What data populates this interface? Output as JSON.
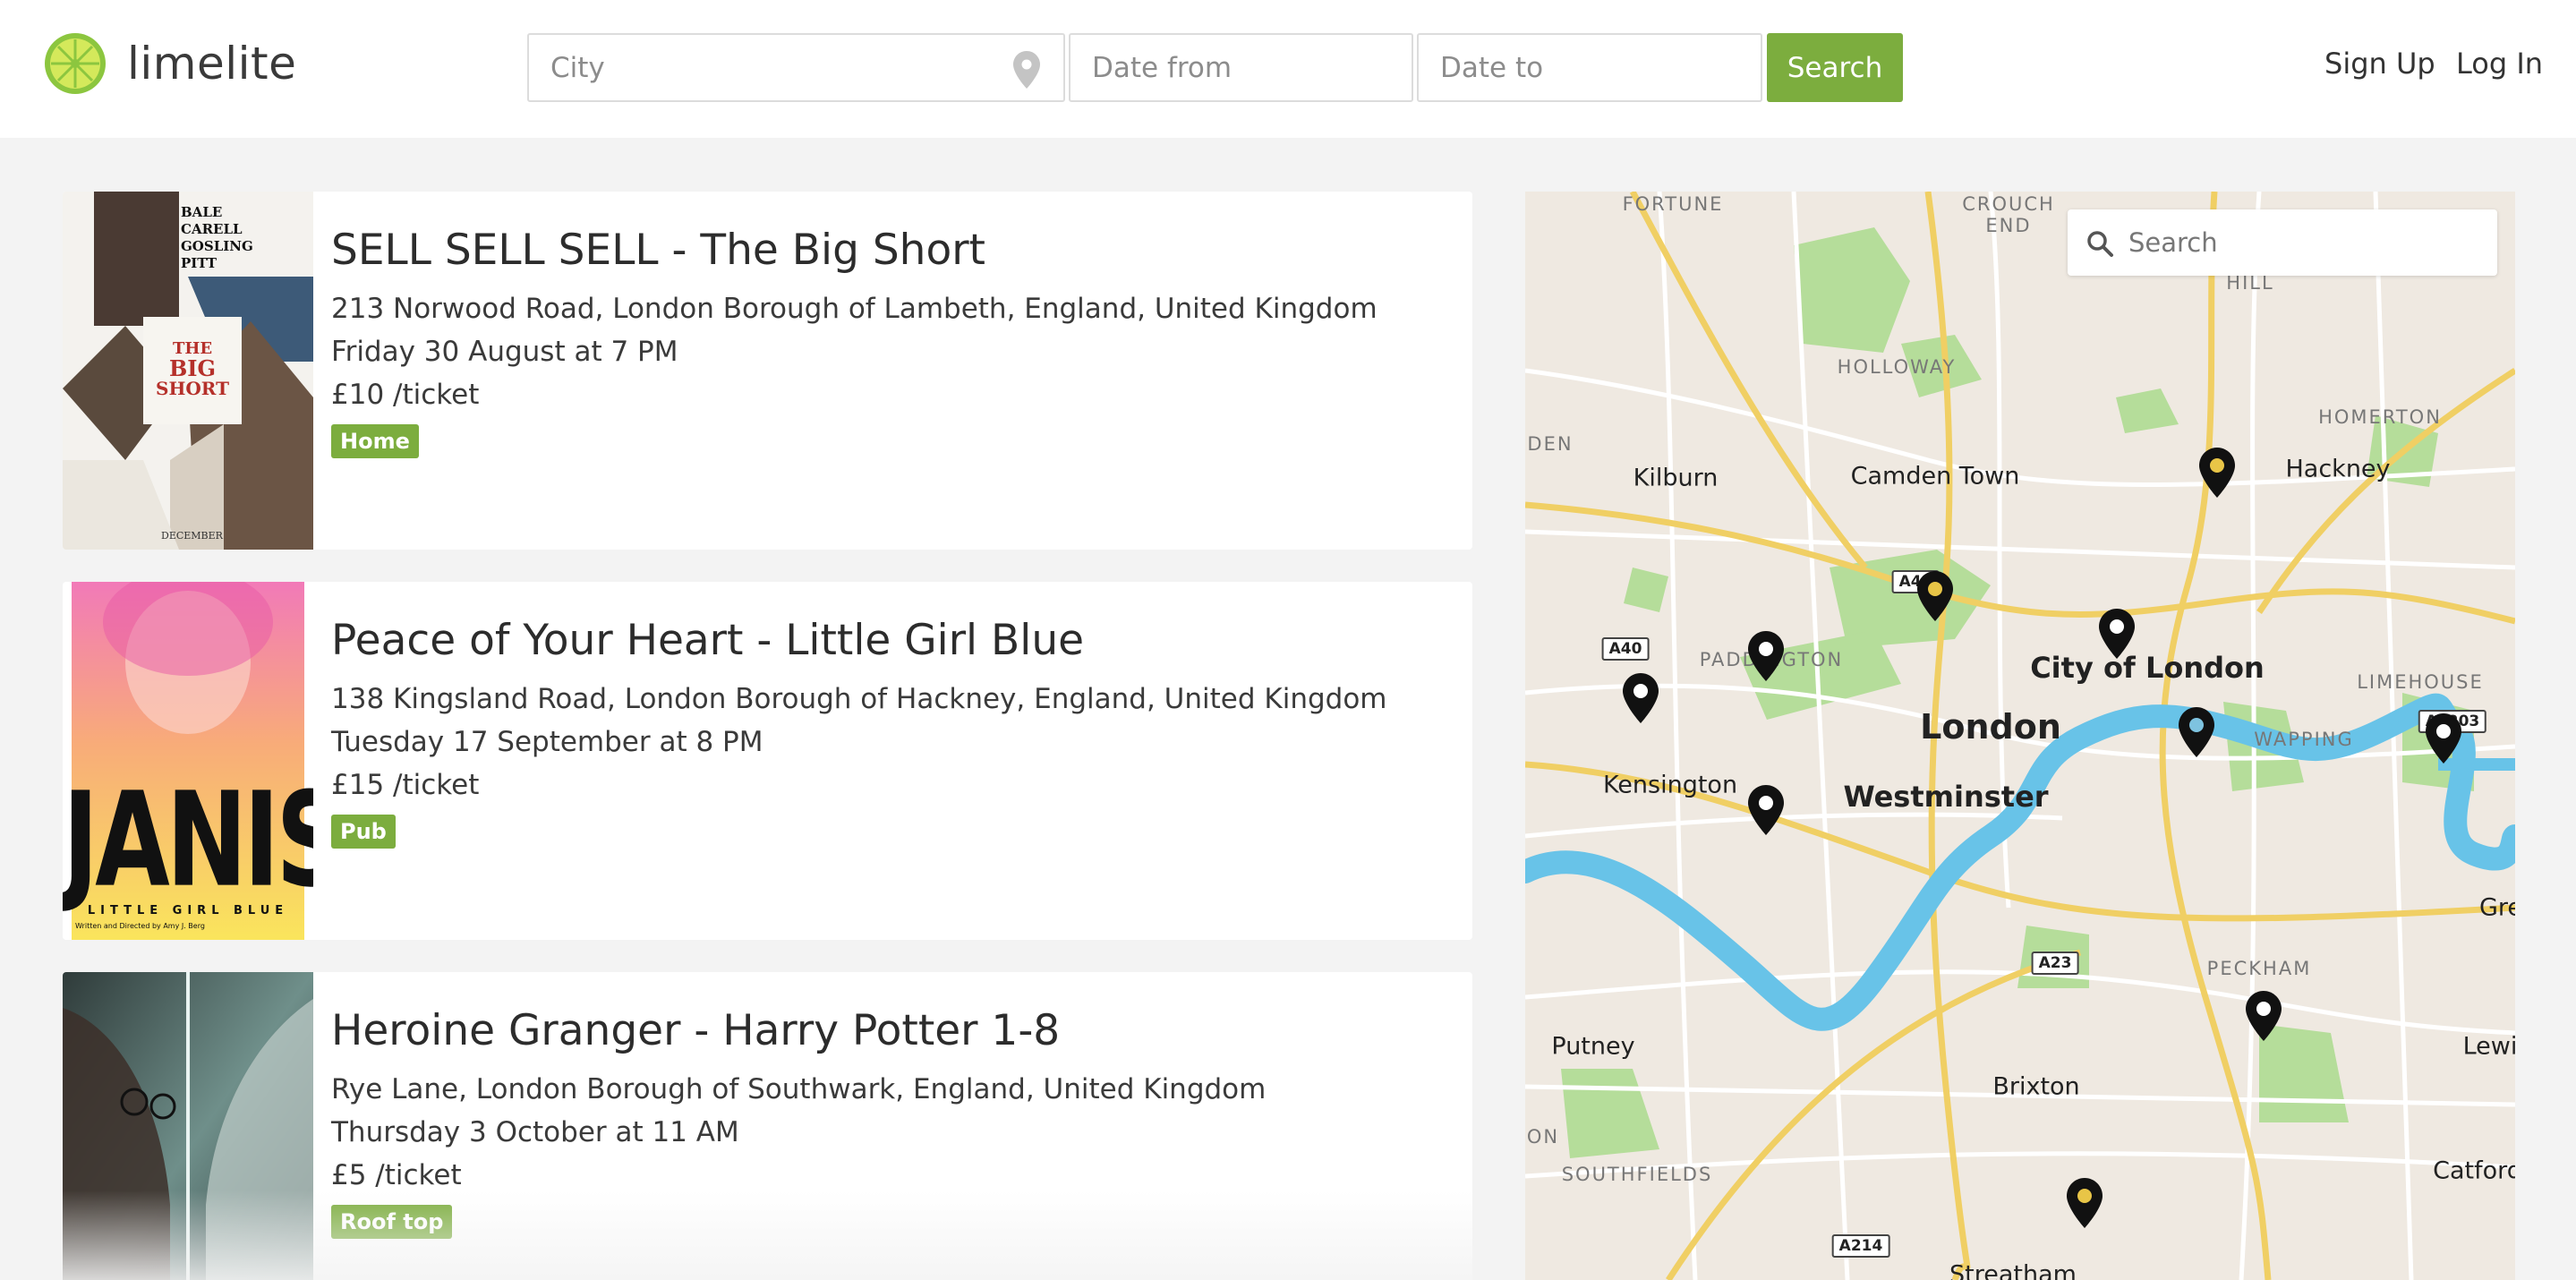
{
  "brand": {
    "name": "limelite",
    "accent": "#7cad3e"
  },
  "search": {
    "city_placeholder": "City",
    "date_from_placeholder": "Date from",
    "date_to_placeholder": "Date to",
    "button_label": "Search"
  },
  "nav": {
    "signup": "Sign Up",
    "login": "Log In"
  },
  "listings": [
    {
      "title": "SELL SELL SELL - The Big Short",
      "address": "213 Norwood Road, London Borough of Lambeth, England, United Kingdom",
      "datetime": "Friday 30 August at 7 PM",
      "price": "£10 /ticket",
      "tag": "Home",
      "poster": {
        "names": [
          "BALE",
          "CARELL",
          "GOSLING",
          "PITT"
        ],
        "title_line1": "THE",
        "title_line2": "BIG",
        "title_line3": "SHORT",
        "footer": "DECEMBER"
      }
    },
    {
      "title": "Peace of Your Heart - Little Girl Blue",
      "address": "138 Kingsland Road, London Borough of Hackney, England, United Kingdom",
      "datetime": "Tuesday 17 September at 8 PM",
      "price": "£15 /ticket",
      "tag": "Pub",
      "poster": {
        "title": "JANIS",
        "subtitle": "LITTLE GIRL BLUE",
        "credit": "Written and Directed by Amy J. Berg"
      }
    },
    {
      "title": "Heroine Granger - Harry Potter 1-8",
      "address": "Rye Lane, London Borough of Southwark, England, United Kingdom",
      "datetime": "Thursday 3 October at 11 AM",
      "price": "£5 /ticket",
      "tag": "Roof top"
    }
  ],
  "map": {
    "search_placeholder": "Search",
    "labels": {
      "fortune": "FORTUNE",
      "crouch_end": "CROUCH\nEND",
      "hill": "HILL",
      "holloway": "HOLLOWAY",
      "homerton": "HOMERTON",
      "den": "DEN",
      "kilburn": "Kilburn",
      "camden_town": "Camden Town",
      "hackney": "Hackney",
      "paddington": "PADDINGTON",
      "city_of_london": "City of London",
      "limehouse": "LIMEHOUSE",
      "london": "London",
      "wapping": "WAPPING",
      "kensington": "Kensington",
      "westminster": "Westminster",
      "gre": "Gre",
      "peckham": "PECKHAM",
      "putney": "Putney",
      "lewis": "Lewis",
      "brixton": "Brixton",
      "on": "ON",
      "southfields": "SOUTHFIELDS",
      "catford": "Catford",
      "streatham": "Streatham"
    },
    "road_shields": {
      "a40": "A40",
      "a41": "A41",
      "a23": "A23",
      "a214": "A214",
      "a13": "A1203"
    },
    "markers": [
      {
        "name": "hackney",
        "color": "#e8c547"
      },
      {
        "name": "camden",
        "color": "#e8c547"
      },
      {
        "name": "city",
        "color": "#ffffff"
      },
      {
        "name": "paddington",
        "color": "#ffffff"
      },
      {
        "name": "west",
        "color": "#ffffff"
      },
      {
        "name": "wapping",
        "color": "#7ec3e0"
      },
      {
        "name": "limehouse",
        "color": "#ffffff"
      },
      {
        "name": "kensington",
        "color": "#ffffff"
      },
      {
        "name": "peckham",
        "color": "#ffffff"
      },
      {
        "name": "brixton",
        "color": "#e8c547"
      }
    ]
  }
}
